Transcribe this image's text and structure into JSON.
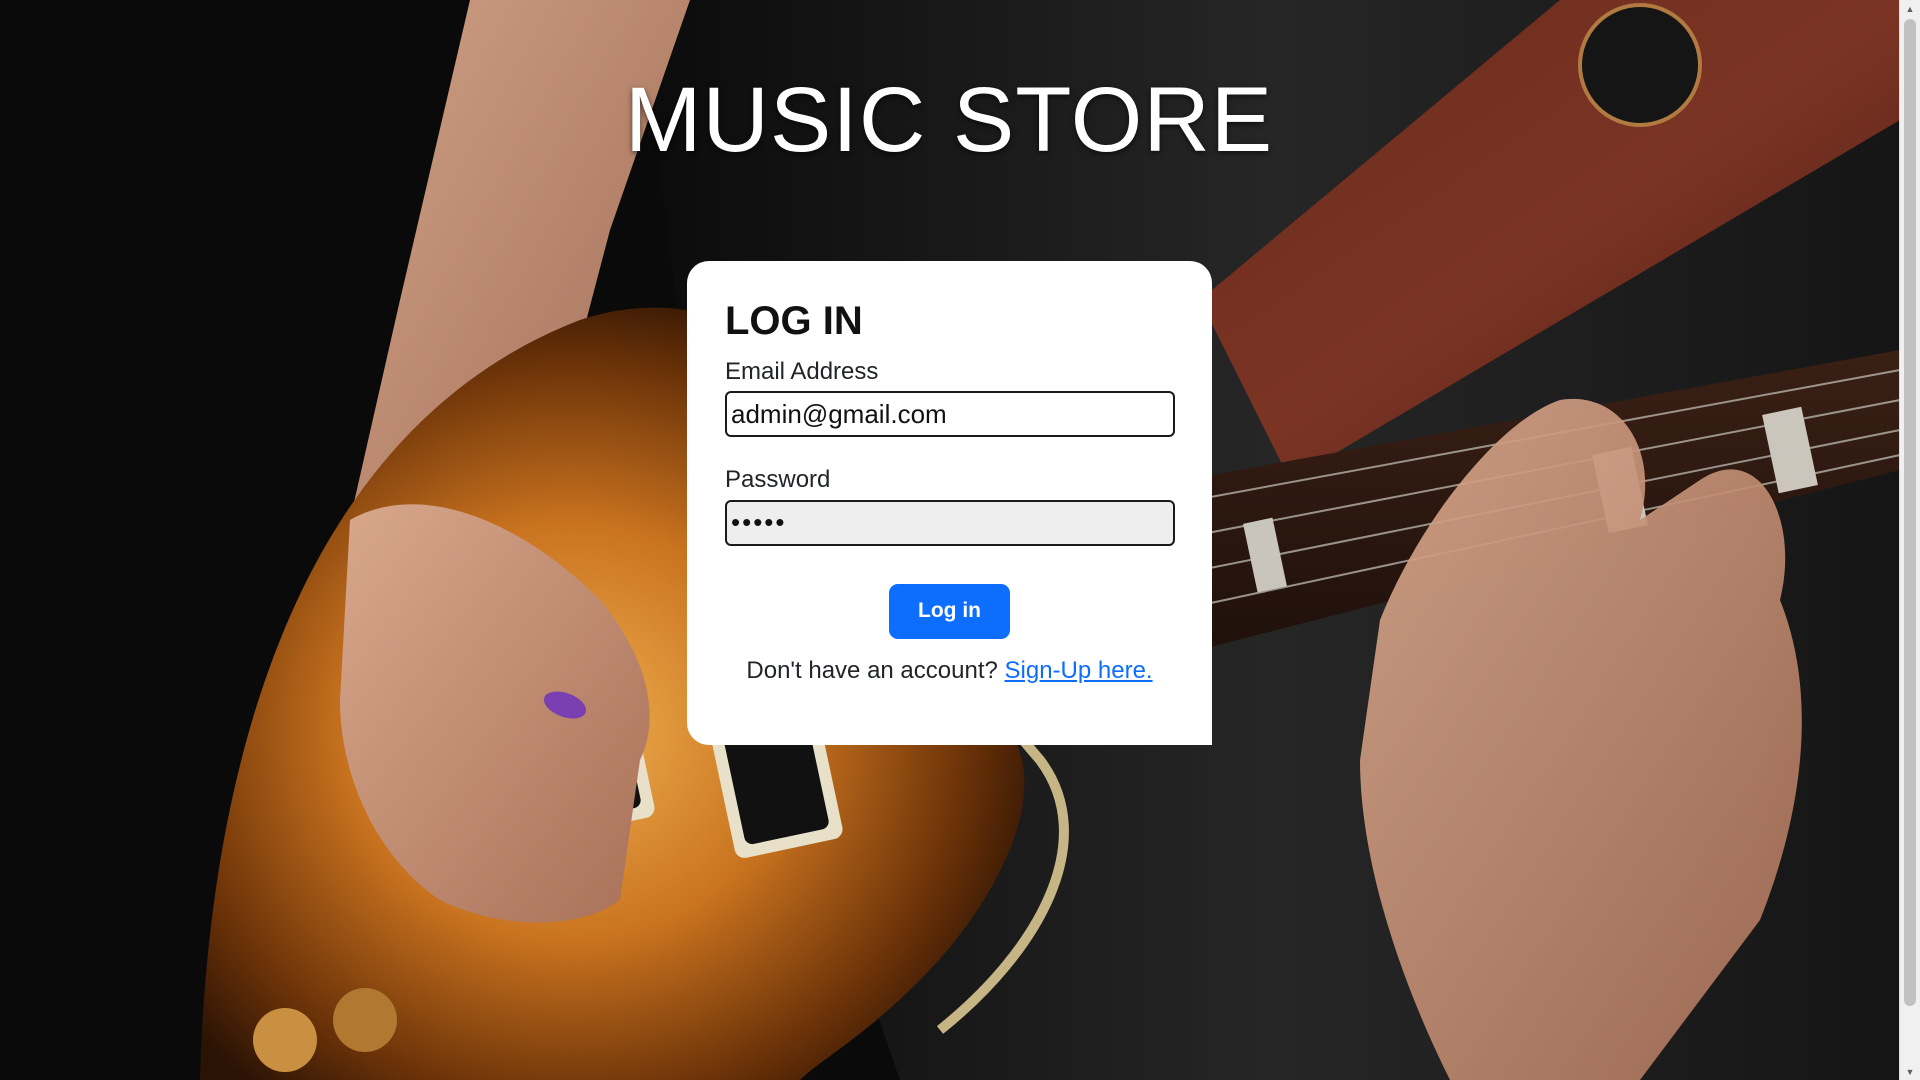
{
  "header": {
    "title": "MUSIC STORE"
  },
  "login_form": {
    "heading": "LOG IN",
    "email_label": "Email Address",
    "email_value": "admin@gmail.com",
    "password_label": "Password",
    "password_value": "•••••",
    "submit_label": "Log in",
    "signup_prompt": "Don't have an account?",
    "signup_link": "Sign-Up here."
  },
  "colors": {
    "primary_button": "#0d6efd",
    "link": "#0d6efd",
    "card_background": "#ffffff"
  },
  "icons": {
    "scroll_up": "scroll-up-arrow-icon",
    "scroll_down": "scroll-down-arrow-icon"
  }
}
